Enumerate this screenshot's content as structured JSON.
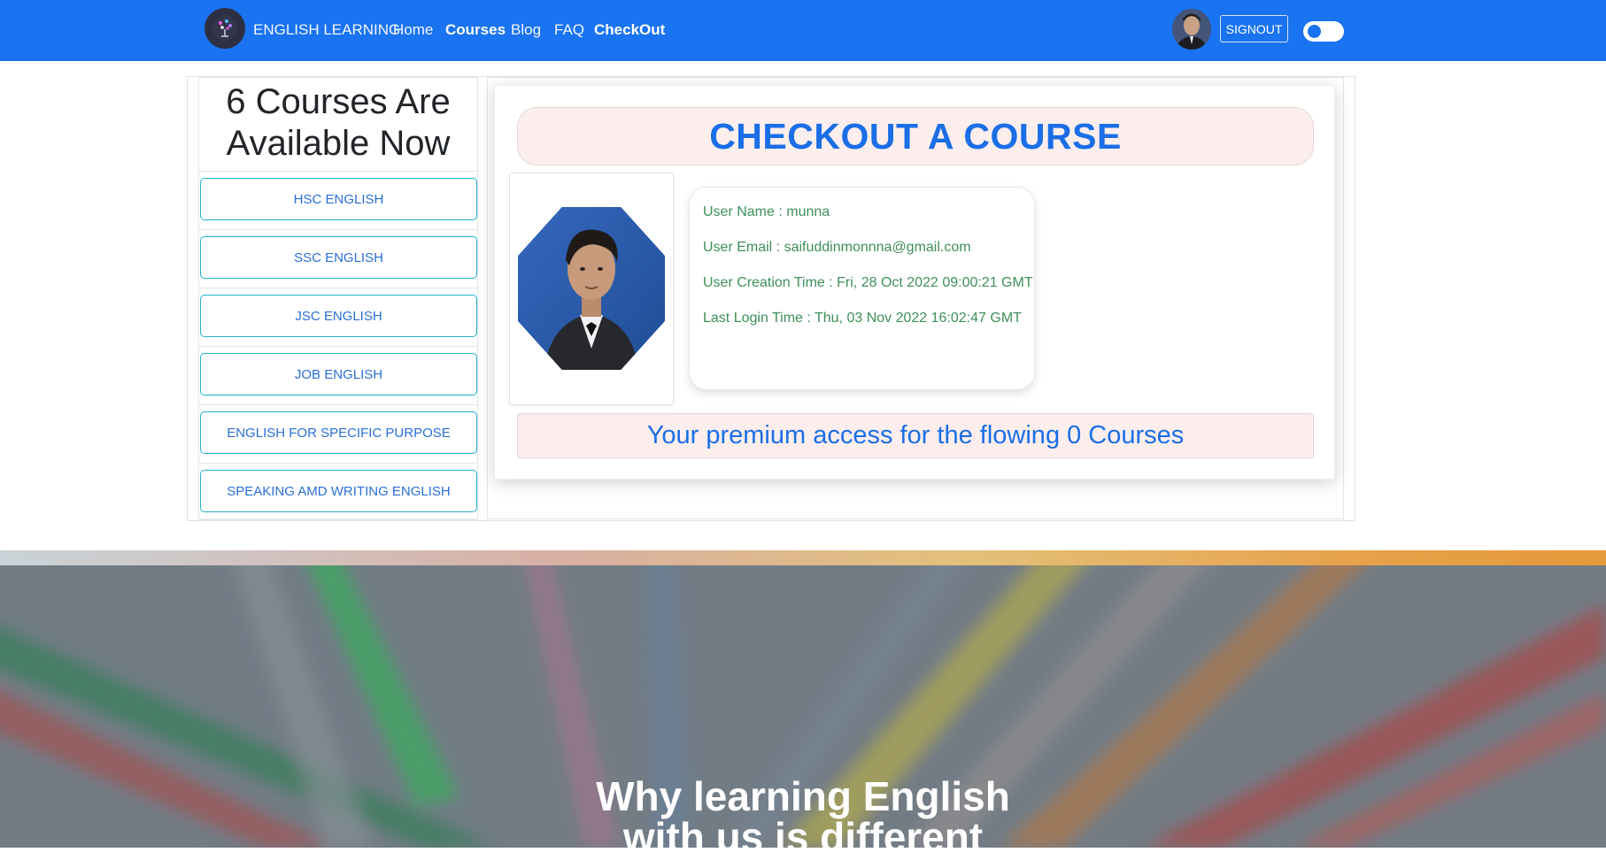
{
  "nav": {
    "brand": "ENGLISH LEARNING",
    "links": [
      "Home",
      "Courses",
      "Blog",
      "FAQ",
      "CheckOut"
    ],
    "signout_label": "SIGNOUT",
    "bg_color": "#1a73f0"
  },
  "sidebar": {
    "title_line1": "6 Courses Are",
    "title_line2": "Available Now",
    "courses": [
      "HSC ENGLISH",
      "SSC ENGLISH",
      "JSC ENGLISH",
      "JOB ENGLISH",
      "ENGLISH FOR SPECIFIC PURPOSE",
      "SPEAKING AMD WRITING ENGLISH"
    ]
  },
  "checkout": {
    "title": "CHECKOUT A COURSE",
    "user_name": "User Name : munna",
    "user_email": "User Email : saifuddinmonnna@gmail.com",
    "creation_time": "User Creation Time : Fri, 28 Oct 2022 09:00:21 GMT",
    "last_login": "Last Login Time : Thu, 03 Nov 2022 16:02:47 GMT",
    "premium_text": "Your premium access for the flowing 0 Courses"
  },
  "hero": {
    "title_line1": "Why learning English",
    "title_line2": "with us is different"
  },
  "icons": {
    "logo": "brain-logo-icon",
    "avatar": "user-avatar",
    "theme_toggle": "theme-toggle-switch"
  }
}
